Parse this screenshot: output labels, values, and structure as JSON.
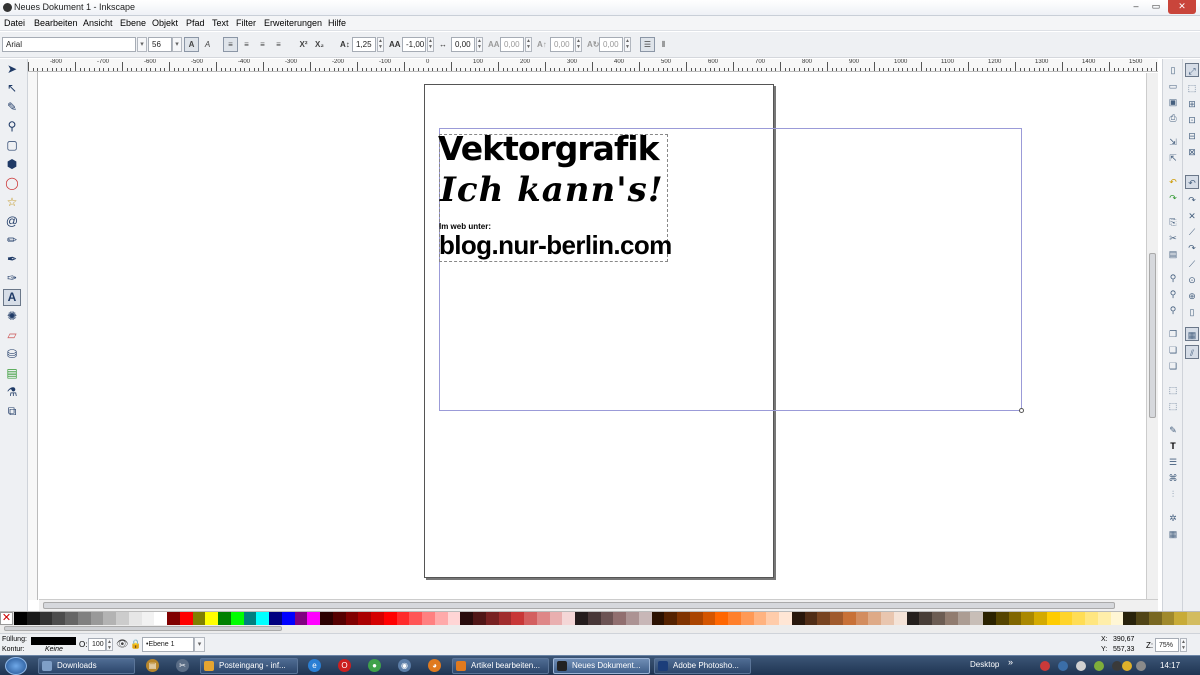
{
  "window": {
    "title": "Neues Dokument 1 - Inkscape",
    "buttons": [
      "–",
      "▭",
      "✕"
    ]
  },
  "menu": [
    "Datei",
    "Bearbeiten",
    "Ansicht",
    "Ebene",
    "Objekt",
    "Pfad",
    "Text",
    "Filter",
    "Erweiterungen",
    "Hilfe"
  ],
  "text_toolbar": {
    "font_family": "Arial",
    "font_size": "56",
    "line_spacing": "1,25",
    "letter_spacing": "-1,00",
    "word_spacing": "0,00",
    "kerning": "0,00",
    "vertical_shift": "0,00",
    "rotation": "0,00",
    "bold_label": "A",
    "italic_label": "A",
    "superscript_label": "X²",
    "subscript_label": "X₂"
  },
  "ruler": {
    "labels": [
      "-800",
      "-700",
      "-600",
      "-500",
      "-400",
      "-300",
      "-200",
      "-100",
      "0",
      "100",
      "200",
      "300",
      "400",
      "500",
      "600",
      "700",
      "800",
      "900",
      "1000",
      "1100",
      "1200",
      "1300",
      "1400",
      "1500"
    ]
  },
  "document": {
    "line1": "Vektorgrafik",
    "line2": "Ich kann's!",
    "line3": "Im web unter:",
    "line4": "blog.nur-berlin.com"
  },
  "status": {
    "fill_label": "Füllung:",
    "stroke_label": "Kontur:",
    "stroke_value": "Keine",
    "opacity_label": "O:",
    "opacity_value": "100",
    "layer": "•Ebene 1",
    "x_label": "X:",
    "x_value": "390,67",
    "y_label": "Y:",
    "y_value": "557,33",
    "zoom_label": "Z:",
    "zoom_value": "75%"
  },
  "palette_colors": [
    "#000000",
    "#1a1a1a",
    "#333333",
    "#4d4d4d",
    "#666666",
    "#808080",
    "#999999",
    "#b3b3b3",
    "#cccccc",
    "#e6e6e6",
    "#f2f2f2",
    "#ffffff",
    "#800000",
    "#ff0000",
    "#808000",
    "#ffff00",
    "#008000",
    "#00ff00",
    "#008080",
    "#00ffff",
    "#000080",
    "#0000ff",
    "#800080",
    "#ff00ff",
    "#2b0000",
    "#550000",
    "#800000",
    "#aa0000",
    "#d40000",
    "#ff0000",
    "#ff2a2a",
    "#ff5555",
    "#ff8080",
    "#ffaaaa",
    "#ffd5d5",
    "#280b0b",
    "#501616",
    "#782121",
    "#a02c2c",
    "#c83737",
    "#d35f5f",
    "#de8787",
    "#e9afaf",
    "#f4d7d7",
    "#241c1c",
    "#483737",
    "#6c5353",
    "#916f6f",
    "#ac9393",
    "#c8b7b7",
    "#2b1100",
    "#552200",
    "#803300",
    "#aa4400",
    "#d45500",
    "#ff6600",
    "#ff7f2a",
    "#ff9955",
    "#ffb380",
    "#ffccaa",
    "#ffe6d5",
    "#28170b",
    "#502d16",
    "#784421",
    "#a05a2c",
    "#c87137",
    "#d38d5f",
    "#deaa87",
    "#e9c6af",
    "#f4e3d7",
    "#241f1c",
    "#483e37",
    "#6c5d53",
    "#917c6f",
    "#ac9d93",
    "#c8beb7",
    "#2b2200",
    "#554400",
    "#806600",
    "#aa8800",
    "#d4aa00",
    "#ffcc00",
    "#ffd42a",
    "#ffdd55",
    "#ffe680",
    "#ffeeaa",
    "#fff6d5",
    "#28220b",
    "#504416",
    "#786721",
    "#a0892c",
    "#c8ab37",
    "#d3bc5f"
  ],
  "taskbar": {
    "items": [
      "Downloads",
      "Posteingang - inf...",
      "Artikel bearbeiten...",
      "Neues Dokument...",
      "Adobe Photosho..."
    ],
    "desktop_label": "Desktop",
    "clock": "14:17"
  },
  "icons": {
    "tools": [
      "selector-icon",
      "node-icon",
      "tweak-icon",
      "zoom-icon",
      "rect-icon",
      "3dbox-icon",
      "ellipse-icon",
      "star-icon",
      "spiral-icon",
      "pencil-icon",
      "pen-icon",
      "calligraphy-icon",
      "text-icon",
      "spray-icon",
      "eraser-icon",
      "bucket-icon",
      "gradient-icon",
      "dropper-icon",
      "connector-icon"
    ]
  }
}
